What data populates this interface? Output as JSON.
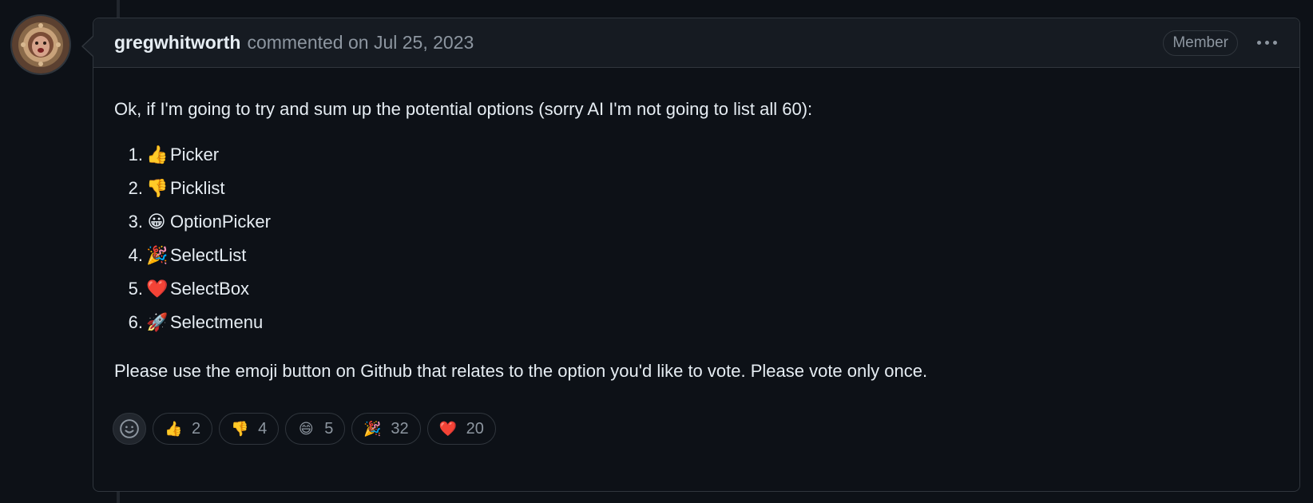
{
  "comment": {
    "author": "gregwhitworth",
    "meta": "commented on Jul 25, 2023",
    "badge": "Member",
    "intro": "Ok, if I'm going to try and sum up the potential options (sorry AI I'm not going to list all 60):",
    "options": [
      {
        "number": "1.",
        "emoji": "👍",
        "label": "Picker"
      },
      {
        "number": "2.",
        "emoji": "👎",
        "label": "Picklist"
      },
      {
        "number": "3.",
        "emoji": "😀",
        "label": "OptionPicker"
      },
      {
        "number": "4.",
        "emoji": "🎉",
        "label": "SelectList"
      },
      {
        "number": "5.",
        "emoji": "❤️",
        "label": "SelectBox"
      },
      {
        "number": "6.",
        "emoji": "🚀",
        "label": "Selectmenu"
      }
    ],
    "outro": "Please use the emoji button on Github that relates to the option you'd like to vote. Please vote only once."
  },
  "reactions": [
    {
      "emoji": "👍",
      "icon": "thumbs-up-icon",
      "count": "2"
    },
    {
      "emoji": "👎",
      "icon": "thumbs-down-icon",
      "count": "4"
    },
    {
      "emoji": "😄",
      "icon": "laugh-icon",
      "count": "5"
    },
    {
      "emoji": "🎉",
      "icon": "hooray-icon",
      "count": "32"
    },
    {
      "emoji": "❤️",
      "icon": "heart-icon",
      "count": "20"
    }
  ],
  "icons": {
    "add_reaction": "smiley-icon",
    "menu": "kebab-horizontal-icon",
    "avatar": "user-avatar"
  },
  "colors": {
    "background": "#0d1117",
    "header_bg": "#161b22",
    "border": "#30363d",
    "text": "#e6edf3",
    "muted": "#8d96a0"
  }
}
